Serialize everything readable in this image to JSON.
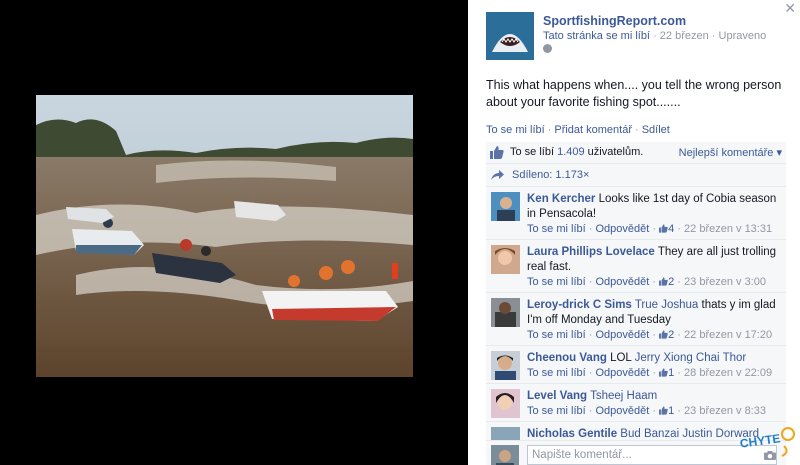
{
  "photo": {
    "alt_name": "speedboats-racing-on-river"
  },
  "page": {
    "name": "SportfishingReport.com",
    "like_toggle": "Tato stránka se mi líbí",
    "date": "22 březen",
    "edited": "Upraveno"
  },
  "post": {
    "text": "This what happens when.... you tell the wrong person about your favorite fishing spot......."
  },
  "actions": {
    "like": "To se mi líbí",
    "comment": "Přidat komentář",
    "share": "Sdílet",
    "sep": "·"
  },
  "likes": {
    "prefix": "To se líbí ",
    "count": "1.409",
    "suffix": " uživatelům.",
    "sort": "Nejlepší komentáře ▾"
  },
  "shares": {
    "label": "Sdíleno: 1.173×"
  },
  "comments": [
    {
      "name": "Ken Kercher",
      "tag": "",
      "text": " Looks like 1st day of Cobia season in Pensacola!",
      "like": "To se mi líbí",
      "reply": "Odpovědět",
      "likes": "4",
      "time": "22 březen v 13:31"
    },
    {
      "name": "Laura Phillips Lovelace",
      "tag": "",
      "text": " They are all just trolling real fast.",
      "like": "To se mi líbí",
      "reply": "Odpovědět",
      "likes": "2",
      "time": "23 březen v 3:00"
    },
    {
      "name": "Leroy-drick C Sims",
      "tag": " True Joshua",
      "text": " thats y im glad I'm off Monday and Tuesday",
      "like": "To se mi líbí",
      "reply": "Odpovědět",
      "likes": "2",
      "time": "22 březen v 17:20"
    },
    {
      "name": "Cheenou Vang",
      "tag": "",
      "text": " LOL ",
      "tag2": "Jerry Xiong Chai Thor",
      "like": "To se mi líbí",
      "reply": "Odpovědět",
      "likes": "1",
      "time": "28 březen v 22:09"
    },
    {
      "name": "Level Vang",
      "tag": " Tsheej Haam",
      "text": "",
      "like": "To se mi líbí",
      "reply": "Odpovědět",
      "likes": "1",
      "time": "23 březen v 8:33"
    },
    {
      "name": "Nicholas Gentile",
      "tag": " Bud Banzai Justin Dorward",
      "text": ""
    }
  ],
  "reply": {
    "placeholder": "Napište komentář..."
  },
  "watermark": {
    "text": "CHYTE"
  },
  "colors": {
    "link": "#3b5998",
    "muted": "#9197a3",
    "panel": "#f6f7f8",
    "water": "#6b5337"
  }
}
